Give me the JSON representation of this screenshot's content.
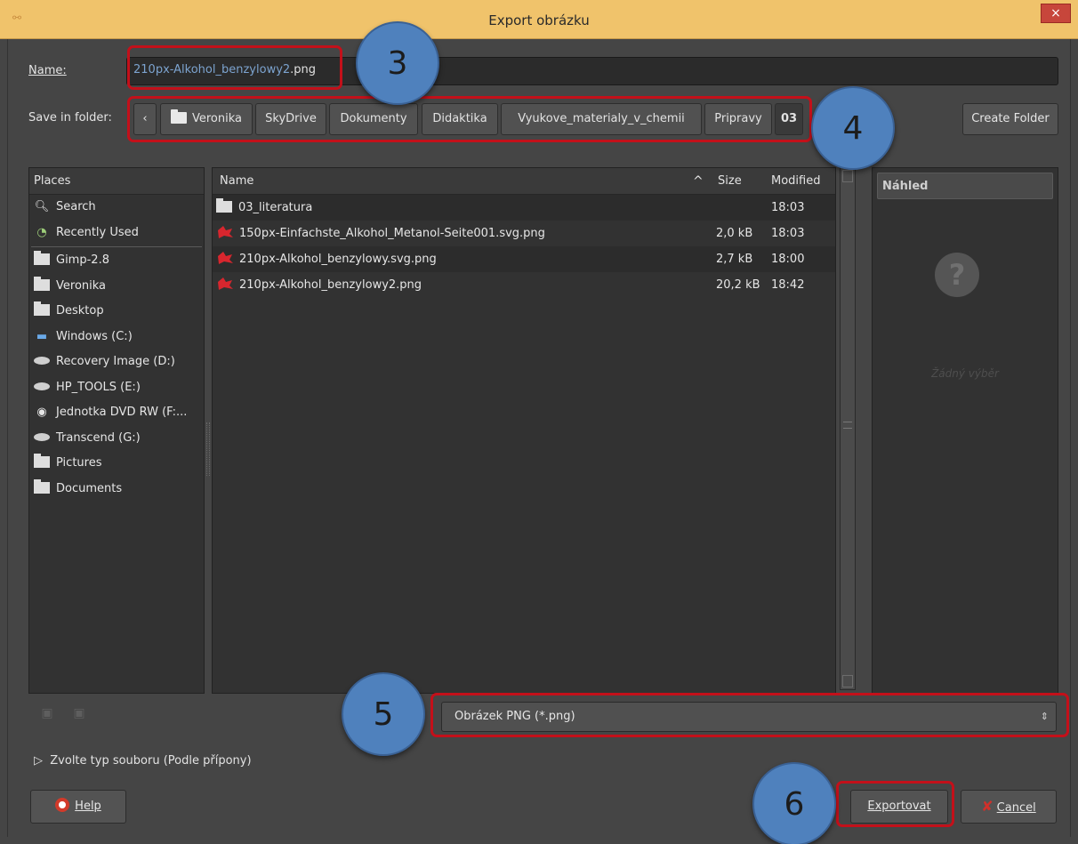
{
  "window": {
    "title": "Export obrázku",
    "close": "×",
    "app_icon": "chain-icon"
  },
  "name_row": {
    "label": "Name:",
    "value_selected": "210px-Alkohol_benzylowy2",
    "value_ext": ".png"
  },
  "folder_row": {
    "label": "Save in folder:",
    "back": "‹",
    "crumbs": [
      "Veronika",
      "SkyDrive",
      "Dokumenty",
      "Didaktika",
      "Vyukove_materialy_v_chemii",
      "Pripravy",
      "03"
    ],
    "create_folder": "Create Folder"
  },
  "places": {
    "header": "Places",
    "items": [
      {
        "label": "Search",
        "icon": "search-icon"
      },
      {
        "label": "Recently Used",
        "icon": "recent-icon"
      },
      {
        "label": "Gimp-2.8",
        "icon": "folder-icon"
      },
      {
        "label": "Veronika",
        "icon": "folder-icon"
      },
      {
        "label": "Desktop",
        "icon": "folder-icon"
      },
      {
        "label": "Windows (C:)",
        "icon": "drive-icon"
      },
      {
        "label": "Recovery Image (D:)",
        "icon": "drive-icon"
      },
      {
        "label": "HP_TOOLS (E:)",
        "icon": "drive-icon"
      },
      {
        "label": "Jednotka DVD RW (F:...",
        "icon": "dvd-icon"
      },
      {
        "label": "Transcend (G:)",
        "icon": "drive-icon"
      },
      {
        "label": "Pictures",
        "icon": "folder-icon"
      },
      {
        "label": "Documents",
        "icon": "folder-icon"
      }
    ]
  },
  "files": {
    "columns": {
      "name": "Name",
      "sort": "^",
      "size": "Size",
      "modified": "Modified"
    },
    "rows": [
      {
        "name": "03_literatura",
        "size": "",
        "modified": "18:03",
        "type": "folder"
      },
      {
        "name": "150px-Einfachste_Alkohol_Metanol-Seite001.svg.png",
        "size": "2,0 kB",
        "modified": "18:03",
        "type": "image"
      },
      {
        "name": "210px-Alkohol_benzylowy.svg.png",
        "size": "2,7 kB",
        "modified": "18:00",
        "type": "image"
      },
      {
        "name": "210px-Alkohol_benzylowy2.png",
        "size": "20,2 kB",
        "modified": "18:42",
        "type": "image"
      }
    ]
  },
  "preview": {
    "header": "Náhled",
    "empty_text": "Žádný výběr"
  },
  "filetype": {
    "value": "Obrázek PNG (*.png)",
    "spin": "⇕"
  },
  "expander": {
    "label": "Zvolte typ souboru (Podle přípony)"
  },
  "buttons": {
    "help": "Help",
    "export": "Exportovat",
    "cancel": "Cancel"
  },
  "callouts": [
    "3",
    "4",
    "5",
    "6"
  ],
  "colors": {
    "accent_red": "#c3101a",
    "badge_blue": "#4f81bd",
    "titlebar": "#f0c36b"
  }
}
